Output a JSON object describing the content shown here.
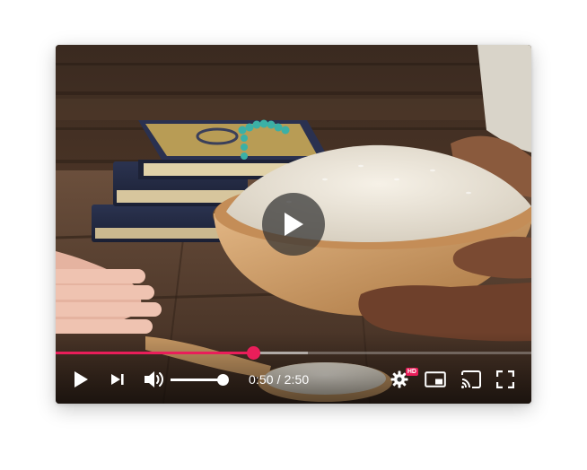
{
  "player": {
    "current_time": "0:50",
    "separator": " / ",
    "duration": "2:50",
    "progress_played": 0.415,
    "progress_buffered": 0.53,
    "volume_level": 1.0,
    "quality_badge": "HD",
    "accent_color": "#e91e5a"
  },
  "icons": {
    "big_play": "play-icon",
    "play": "play-icon",
    "next": "skip-next-icon",
    "volume": "volume-high-icon",
    "settings": "gear-icon",
    "miniplayer": "miniplayer-icon",
    "cast": "cast-icon",
    "fullscreen": "fullscreen-icon"
  }
}
